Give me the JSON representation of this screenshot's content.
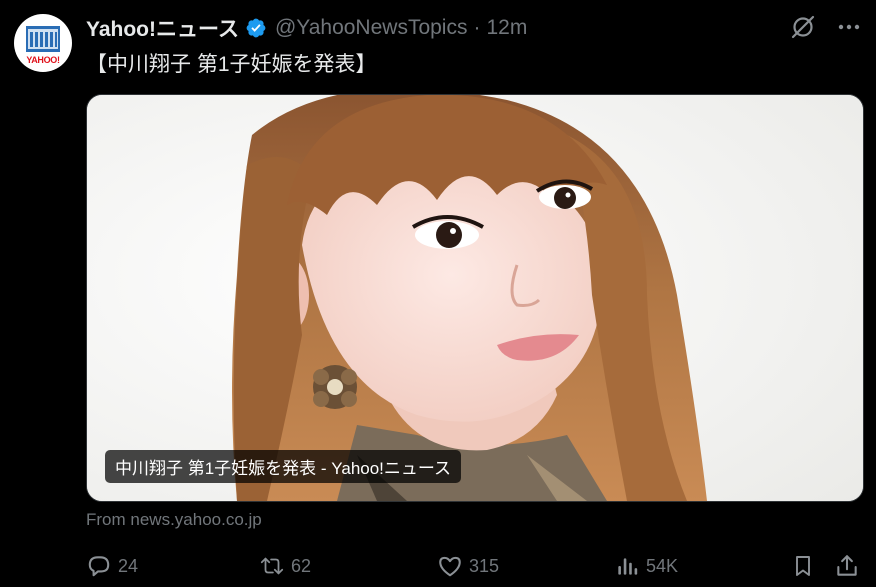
{
  "tweet": {
    "author_name": "Yahoo!ニュース",
    "handle": "@YahooNewsTopics",
    "separator": "·",
    "time": "12m",
    "text": "【中川翔子 第1子妊娠を発表】",
    "avatar_logo_text": "YAHOO!"
  },
  "card": {
    "title": "中川翔子 第1子妊娠を発表 - Yahoo!ニュース",
    "source": "From news.yahoo.co.jp"
  },
  "actions": {
    "replies": "24",
    "reposts": "62",
    "likes": "315",
    "views": "54K"
  },
  "colors": {
    "background": "#000000",
    "text": "#e7e9ea",
    "muted": "#71767b",
    "verified": "#1d9bf0",
    "logo_red": "#e0121b"
  },
  "icons": [
    "verified-badge-icon",
    "grok-icon",
    "more-icon",
    "reply-icon",
    "repost-icon",
    "like-icon",
    "views-icon",
    "bookmark-icon",
    "share-icon"
  ]
}
